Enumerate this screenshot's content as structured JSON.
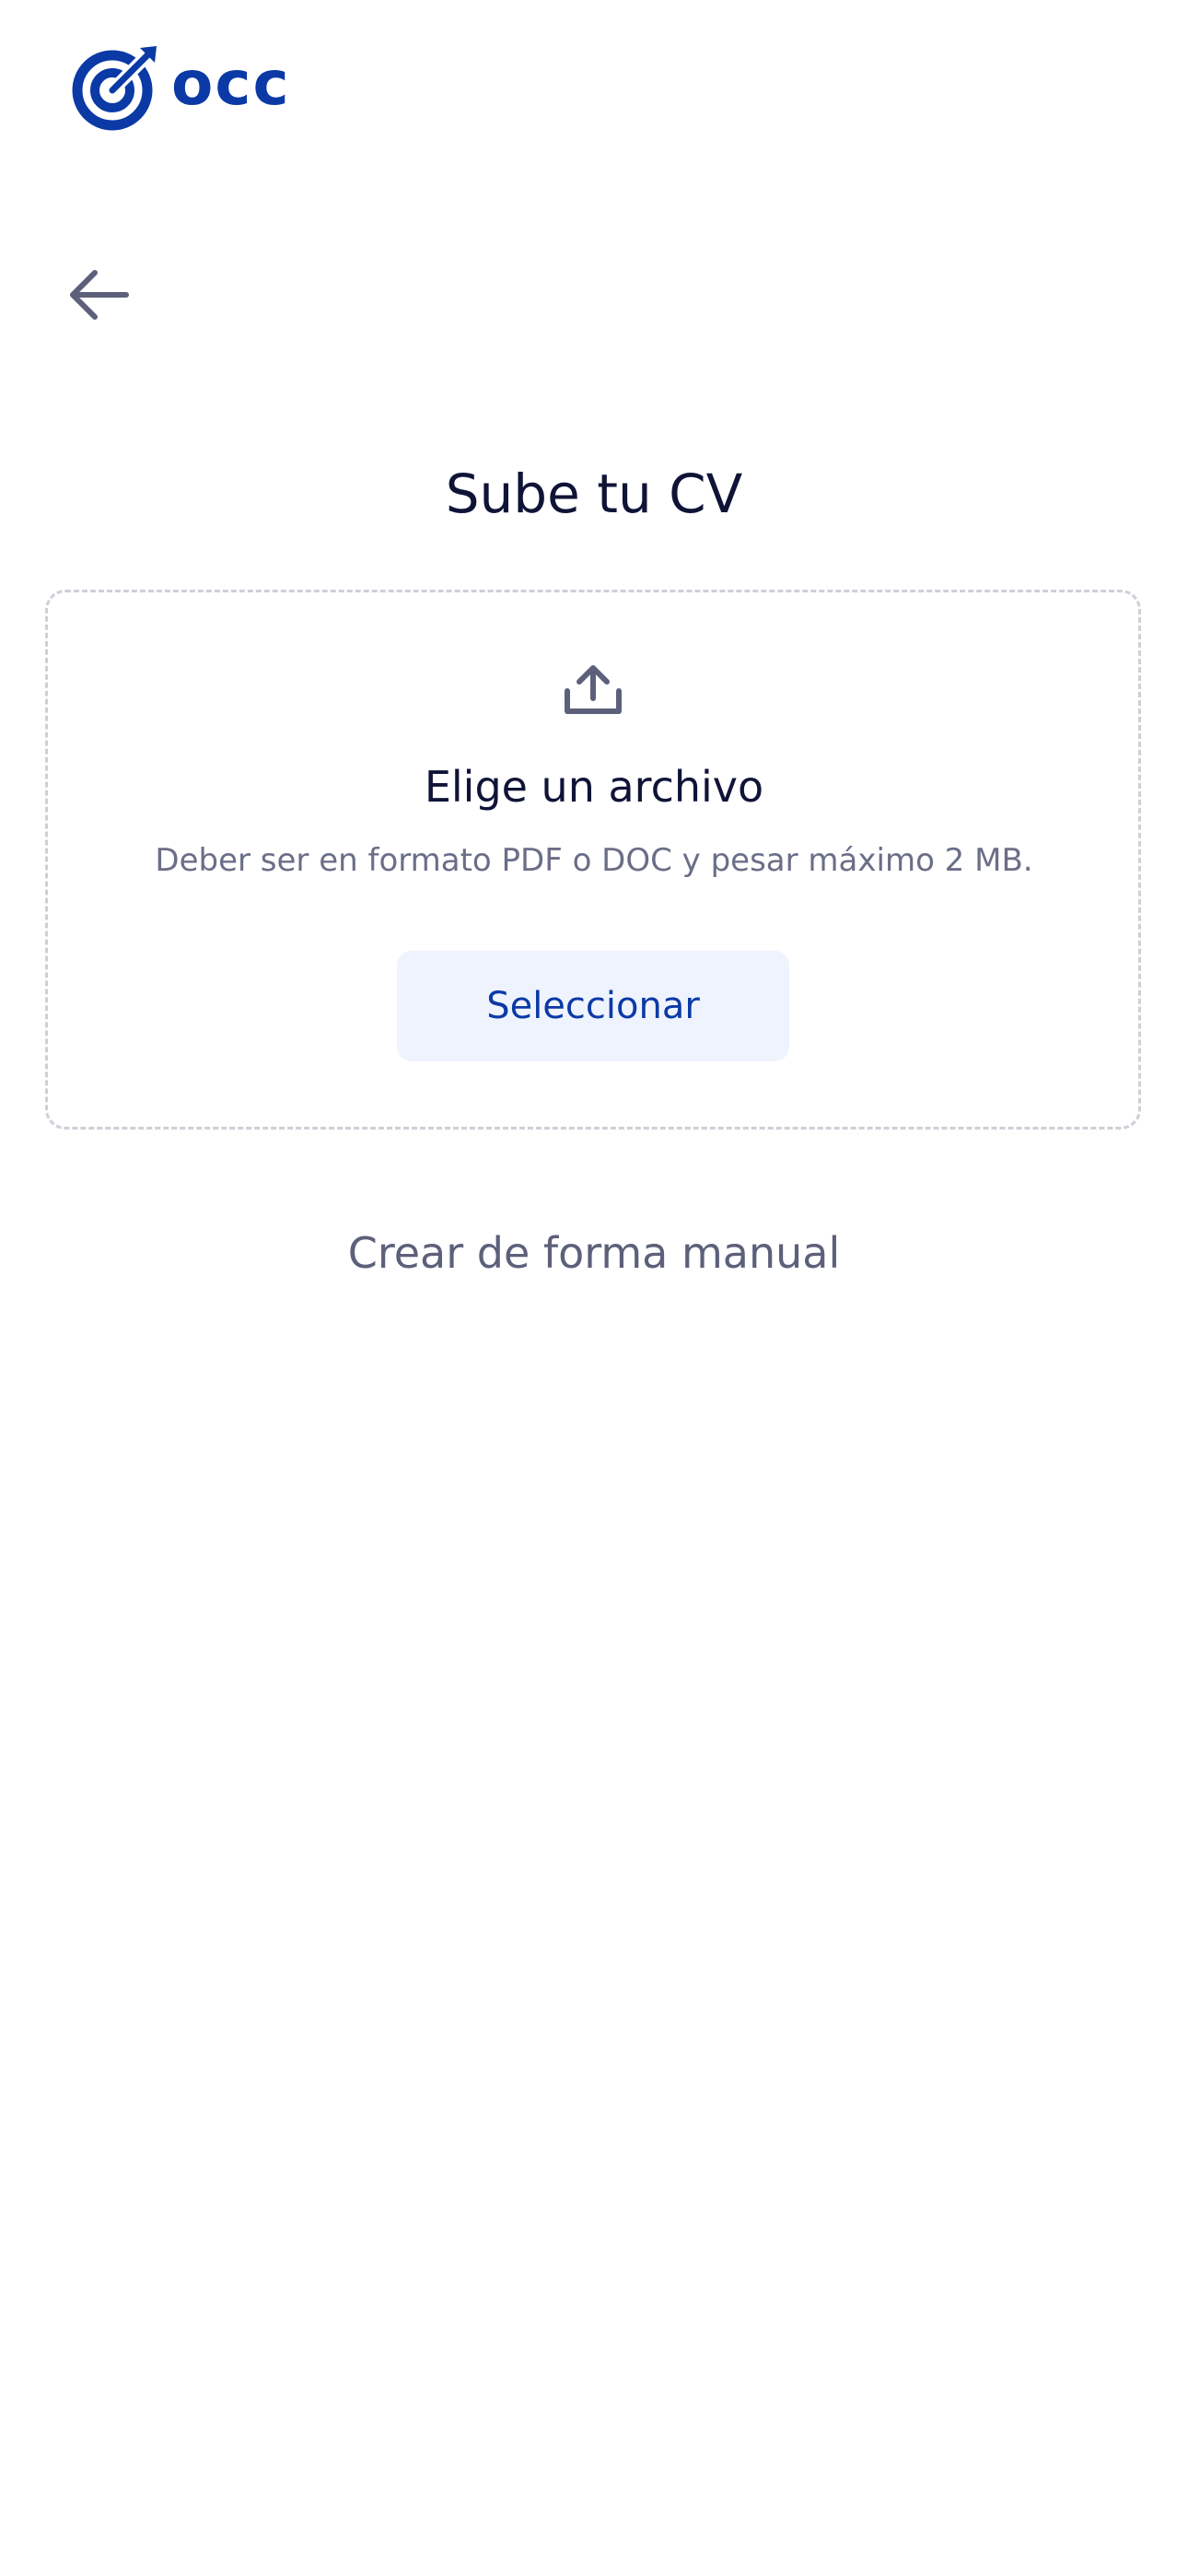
{
  "brand": {
    "name": "occ",
    "color": "#0b3aa6",
    "logo_icon": "target-icon"
  },
  "nav": {
    "back_icon": "arrow-left-icon"
  },
  "page": {
    "title": "Sube tu CV"
  },
  "upload": {
    "icon": "upload-icon",
    "title": "Elige un archivo",
    "subtitle": "Deber ser en formato PDF o DOC y pesar máximo 2 MB.",
    "button_label": "Seleccionar"
  },
  "manual": {
    "link_label": "Crear de forma manual"
  },
  "colors": {
    "heading": "#0f1437",
    "muted": "#6a6e87",
    "button_bg": "#eff3fd",
    "border": "#cdd0d8"
  }
}
